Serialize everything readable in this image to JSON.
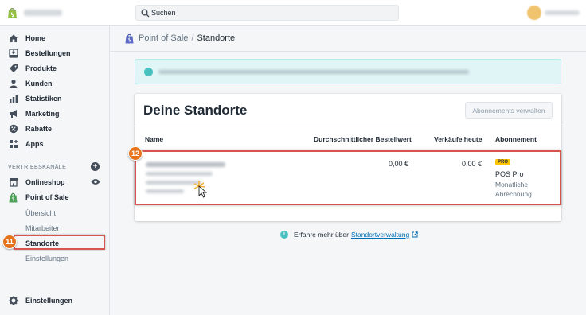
{
  "topbar": {
    "search_placeholder": "Suchen",
    "icons": {
      "logo": "shopify-bag-icon",
      "search": "search-icon"
    }
  },
  "sidebar": {
    "items": [
      {
        "label": "Home",
        "icon": "home-icon"
      },
      {
        "label": "Bestellungen",
        "icon": "orders-icon"
      },
      {
        "label": "Produkte",
        "icon": "tag-icon"
      },
      {
        "label": "Kunden",
        "icon": "person-icon"
      },
      {
        "label": "Statistiken",
        "icon": "bar-chart-icon"
      },
      {
        "label": "Marketing",
        "icon": "megaphone-icon"
      },
      {
        "label": "Rabatte",
        "icon": "discount-icon"
      },
      {
        "label": "Apps",
        "icon": "apps-icon"
      }
    ],
    "section_label": "VERTRIEBSKANÄLE",
    "channels": [
      {
        "label": "Onlineshop",
        "icon": "store-icon"
      },
      {
        "label": "Point of Sale",
        "icon": "shopify-bag-icon"
      }
    ],
    "pos_subitems": [
      "Übersicht",
      "Mitarbeiter",
      "Standorte",
      "Einstellungen"
    ],
    "active_subitem": "Standorte",
    "settings_label": "Einstellungen"
  },
  "callouts": {
    "sidebar_step": "11",
    "row_step": "12"
  },
  "breadcrumb": {
    "parent": "Point of Sale",
    "separator": "/",
    "current": "Standorte"
  },
  "card": {
    "title": "Deine Standorte",
    "manage_button": "Abonnements verwalten",
    "columns": {
      "name": "Name",
      "avg_order": "Durchschnittlicher Bestellwert",
      "sales_today": "Verkäufe heute",
      "subscription": "Abonnement"
    },
    "row": {
      "avg_order": "0,00 €",
      "sales_today": "0,00 €",
      "plan_badge": "PRO",
      "plan_name": "POS Pro",
      "plan_billing": "Monatliche Abrechnung"
    }
  },
  "help": {
    "text": "Erfahre mehr über",
    "link": "Standortverwaltung"
  },
  "colors": {
    "accent_orange": "#e5731d",
    "highlight_red": "#d9534f",
    "pro_yellow": "#ffc400",
    "link_blue": "#006fbb",
    "teal": "#47c1bf"
  }
}
